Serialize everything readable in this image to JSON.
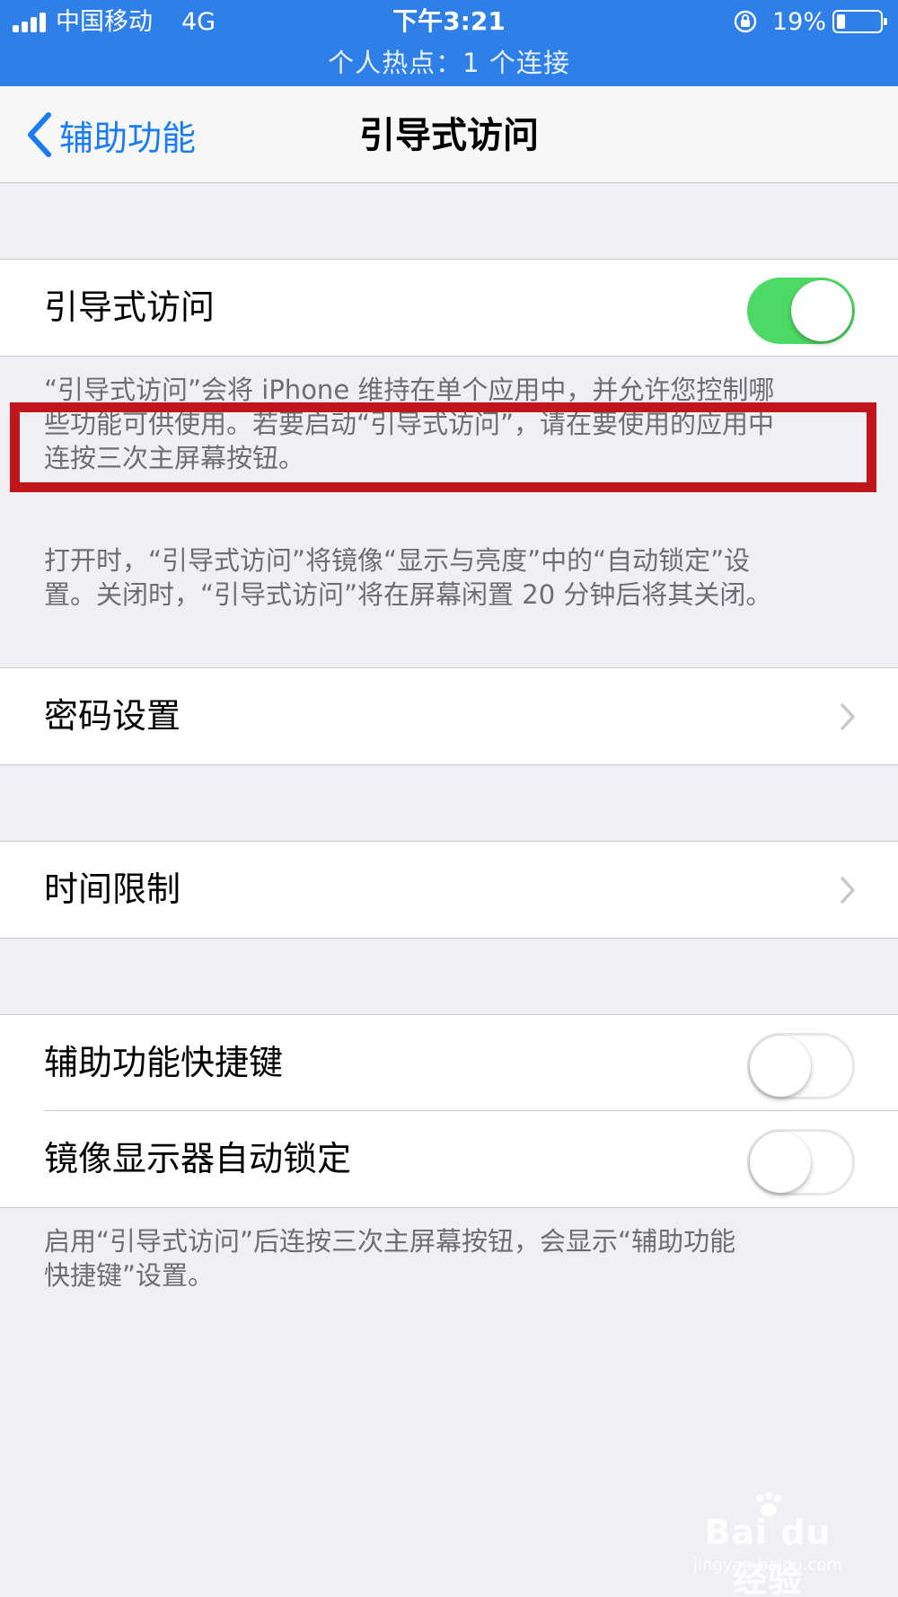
{
  "status_bar": {
    "carrier": "中国移动",
    "network": "4G",
    "time": "下午3:21",
    "battery_percent": "19%",
    "battery_level": 0.19,
    "hotspot": "个人热点：1 个连接"
  },
  "nav": {
    "back_label": "辅助功能",
    "title": "引导式访问",
    "accent_color": "#1a7cf4"
  },
  "sections": {
    "guided_access": {
      "label": "引导式访问",
      "toggle_on": true,
      "description": "“引导式访问”会将 iPhone 维持在单个应用中，并允许您控制哪些功能可供使用。若要启动“引导式访问”，请在要使用的应用中连按三次主屏幕按钮。",
      "description_lines": [
        "“引导式访问”会将 iPhone 维持在单个应用中，并允许您控制哪",
        "些功能可供使用。若要启动“引导式访问”，请在要使用的应用中",
        "连按三次主屏幕按钮。"
      ],
      "auto_lock_note_lines": [
        "打开时，“引导式访问”将镜像“显示与亮度”中的“自动锁定”设",
        "置。关闭时，“引导式访问”将在屏幕闲置 20 分钟后将其关闭。"
      ]
    },
    "passcode": {
      "label": "密码设置"
    },
    "time_limits": {
      "label": "时间限制"
    },
    "shortcuts": {
      "accessibility_shortcut": {
        "label": "辅助功能快捷键",
        "toggle_on": false
      },
      "mirror_auto_lock": {
        "label": "镜像显示器自动锁定",
        "toggle_on": false
      },
      "footer_lines": [
        "启用“引导式访问”后连按三次主屏幕按钮，会显示“辅助功能",
        "快捷键”设置。"
      ]
    }
  },
  "colors": {
    "status_bar_bg": "#2f7fe8",
    "switch_on": "#4cd964",
    "highlight": "#c0151a"
  },
  "watermark": {
    "brand": "Bai du 经验",
    "url": "jingyan.baidu.com"
  }
}
